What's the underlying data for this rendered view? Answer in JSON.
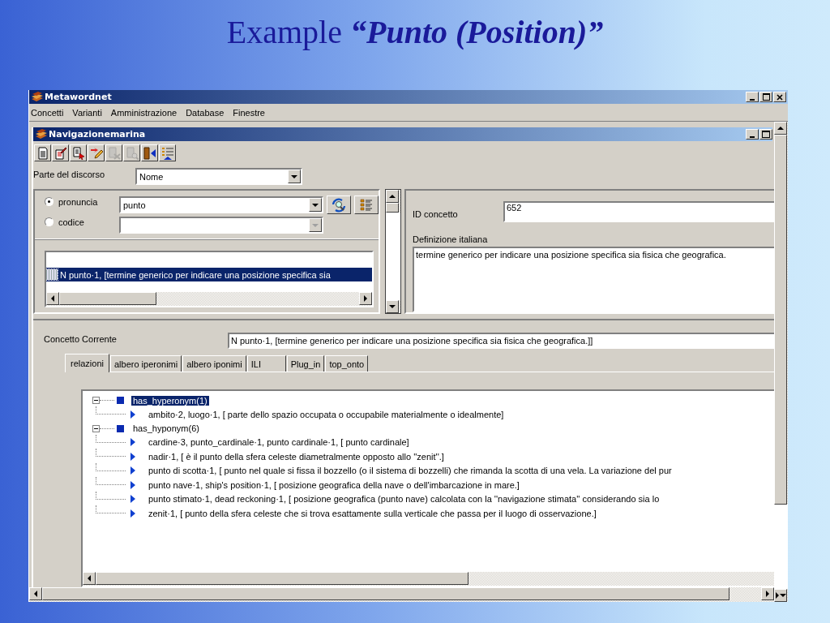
{
  "slide_title": "Example **“Punto (Position)”**",
  "main_window": {
    "title": "Metawordnet",
    "menu": [
      "Concetti",
      "Varianti",
      "Amministrazione",
      "Database",
      "Finestre"
    ]
  },
  "child_window": {
    "title": "Navigazionemarina",
    "toolbar": [
      {
        "kind": "new",
        "disabled": false
      },
      {
        "kind": "edit",
        "disabled": false
      },
      {
        "kind": "select",
        "disabled": false
      },
      {
        "kind": "link",
        "disabled": false
      },
      {
        "kind": "remove",
        "disabled": true
      },
      {
        "kind": "search",
        "disabled": true
      },
      {
        "kind": "exit",
        "disabled": false
      },
      {
        "kind": "list",
        "disabled": false
      }
    ],
    "parte_del_discorso": {
      "label": "Parte del discorso",
      "value": "Nome"
    },
    "search_modes": [
      {
        "label": "pronuncia",
        "selected": true,
        "value": "punto",
        "disabled": false
      },
      {
        "label": "codice",
        "selected": false,
        "disabled": true
      }
    ],
    "results": [
      {
        "text": "N punto·1,  [termine generico per indicare una posizione specifica sia",
        "selected": true
      }
    ],
    "id_concetto": {
      "label": "ID concetto",
      "value": "652"
    },
    "definizione": {
      "label": "Definizione italiana",
      "value": "termine generico per indicare una posizione specifica sia fisica che geografica."
    },
    "concetto_corrente": {
      "label": "Concetto Corrente",
      "value": "N punto·1,  [termine generico per indicare una posizione specifica sia fisica che geografica.]]"
    },
    "tabs": [
      {
        "label": "relazioni",
        "selected": true
      },
      {
        "label": "albero iperonimi",
        "selected": false
      },
      {
        "label": "albero iponimi",
        "selected": false
      },
      {
        "label": "ILI",
        "selected": false
      },
      {
        "label": "Plug_in",
        "selected": false
      },
      {
        "label": "top_onto",
        "selected": false
      }
    ],
    "tree": [
      {
        "label": "has_hyperonym(1)",
        "selected": true,
        "expanded": true,
        "children": [
          {
            "label": "ambito·2,  luogo·1,  [  parte dello spazio occupata o occupabile materialmente o idealmente]"
          }
        ]
      },
      {
        "label": "has_hyponym(6)",
        "selected": false,
        "expanded": true,
        "children": [
          {
            "label": "cardine·3,  punto_cardinale·1,  punto cardinale·1,  [  punto cardinale]"
          },
          {
            "label": "nadir·1,  [  è il punto della sfera celeste diametralmente opposto allo ''zenit''.]"
          },
          {
            "label": "punto di scotta·1,  [  punto nel quale si fissa il bozzello (o il sistema di bozzelli) che rimanda la scotta di una vela. La variazione del pur"
          },
          {
            "label": "punto nave·1,  ship's position·1,  [  posizione geografica della nave o dell'imbarcazione in mare.]"
          },
          {
            "label": "punto stimato·1,  dead reckoning·1,  [  posizione geografica (punto nave) calcolata con la ''navigazione stimata'' considerando sia lo"
          },
          {
            "label": "zenit·1,  [  punto della sfera celeste che si trova esattamente sulla verticale che passa per il luogo di osservazione.]"
          }
        ]
      }
    ]
  }
}
